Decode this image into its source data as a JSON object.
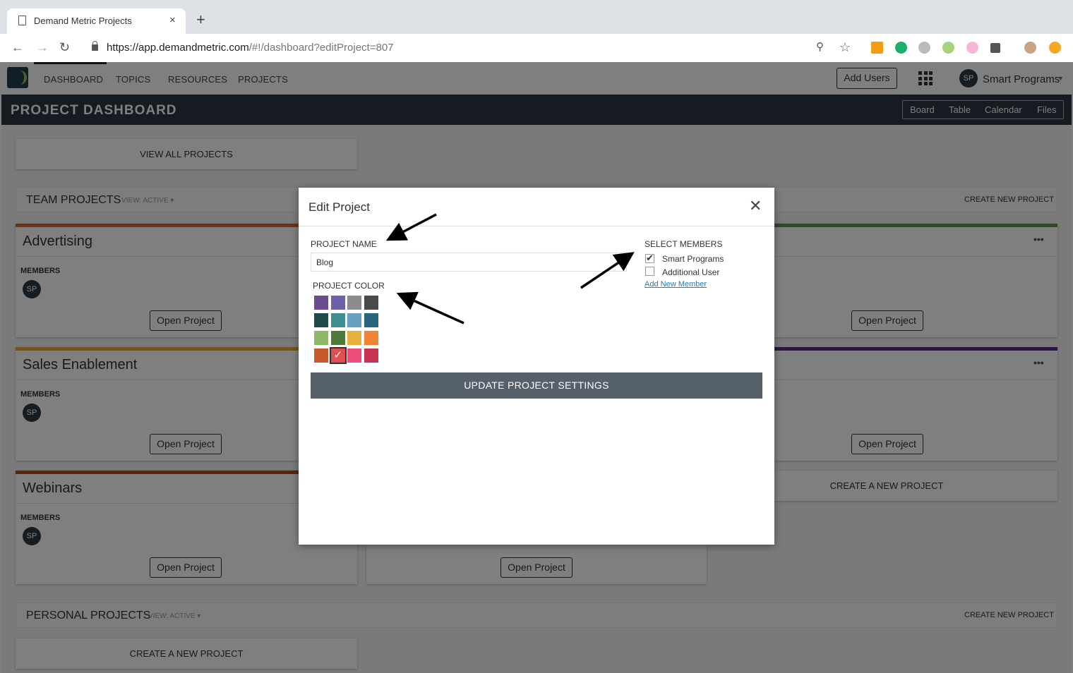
{
  "browser": {
    "tab_title": "Demand Metric Projects",
    "tab_close": "×",
    "new_tab": "+",
    "url_host": "https://app.demandmetric.com",
    "url_path": "/#!/dashboard?editProject=807"
  },
  "nav": {
    "items": [
      "DASHBOARD",
      "TOPICS",
      "RESOURCES",
      "PROJECTS"
    ],
    "add_users": "Add Users",
    "user_initials": "SP",
    "user_name": "Smart Programs"
  },
  "dashboard": {
    "title": "PROJECT DASHBOARD",
    "views": [
      "Board",
      "Table",
      "Calendar",
      "Files"
    ],
    "view_all": "VIEW ALL PROJECTS",
    "team_title": "TEAM PROJECTS",
    "team_view": "VIEW: ACTIVE ▾",
    "team_create": "CREATE NEW PROJECT",
    "personal_title": "PERSONAL PROJECTS",
    "personal_view": "VIEW: ACTIVE ▾",
    "personal_create": "CREATE NEW PROJECT",
    "create_new": "CREATE A NEW PROJECT",
    "members_label": "MEMBERS",
    "open_label": "Open Project",
    "dots": "•••",
    "projects": [
      {
        "name": "Advertising",
        "color": "#e0622a"
      },
      {
        "name": "Sales Enablement",
        "color": "#e9a93a"
      },
      {
        "name": "Webinars",
        "color": "#b8451c"
      }
    ],
    "right_colors": [
      "#5c9a3c",
      "#5b2c86"
    ]
  },
  "modal": {
    "title": "Edit Project",
    "close": "✕",
    "name_label": "PROJECT NAME",
    "name_value": "Blog",
    "color_label": "PROJECT COLOR",
    "members_label": "SELECT MEMBERS",
    "members": [
      {
        "name": "Smart Programs",
        "checked": true
      },
      {
        "name": "Additional User",
        "checked": false
      }
    ],
    "add_member": "Add New Member",
    "update": "UPDATE PROJECT SETTINGS",
    "colors": [
      "#6b4a8e",
      "#6e5fa6",
      "#8c8c8c",
      "#4a4a4a",
      "#1e4a4c",
      "#3e8f8f",
      "#6a9fc4",
      "#2a6580",
      "#8fb866",
      "#4f7a3a",
      "#e6b13a",
      "#ee8433",
      "#c9592a",
      "#e24f4f",
      "#ef4d7a",
      "#c7334f"
    ],
    "selected_color_index": 13
  }
}
